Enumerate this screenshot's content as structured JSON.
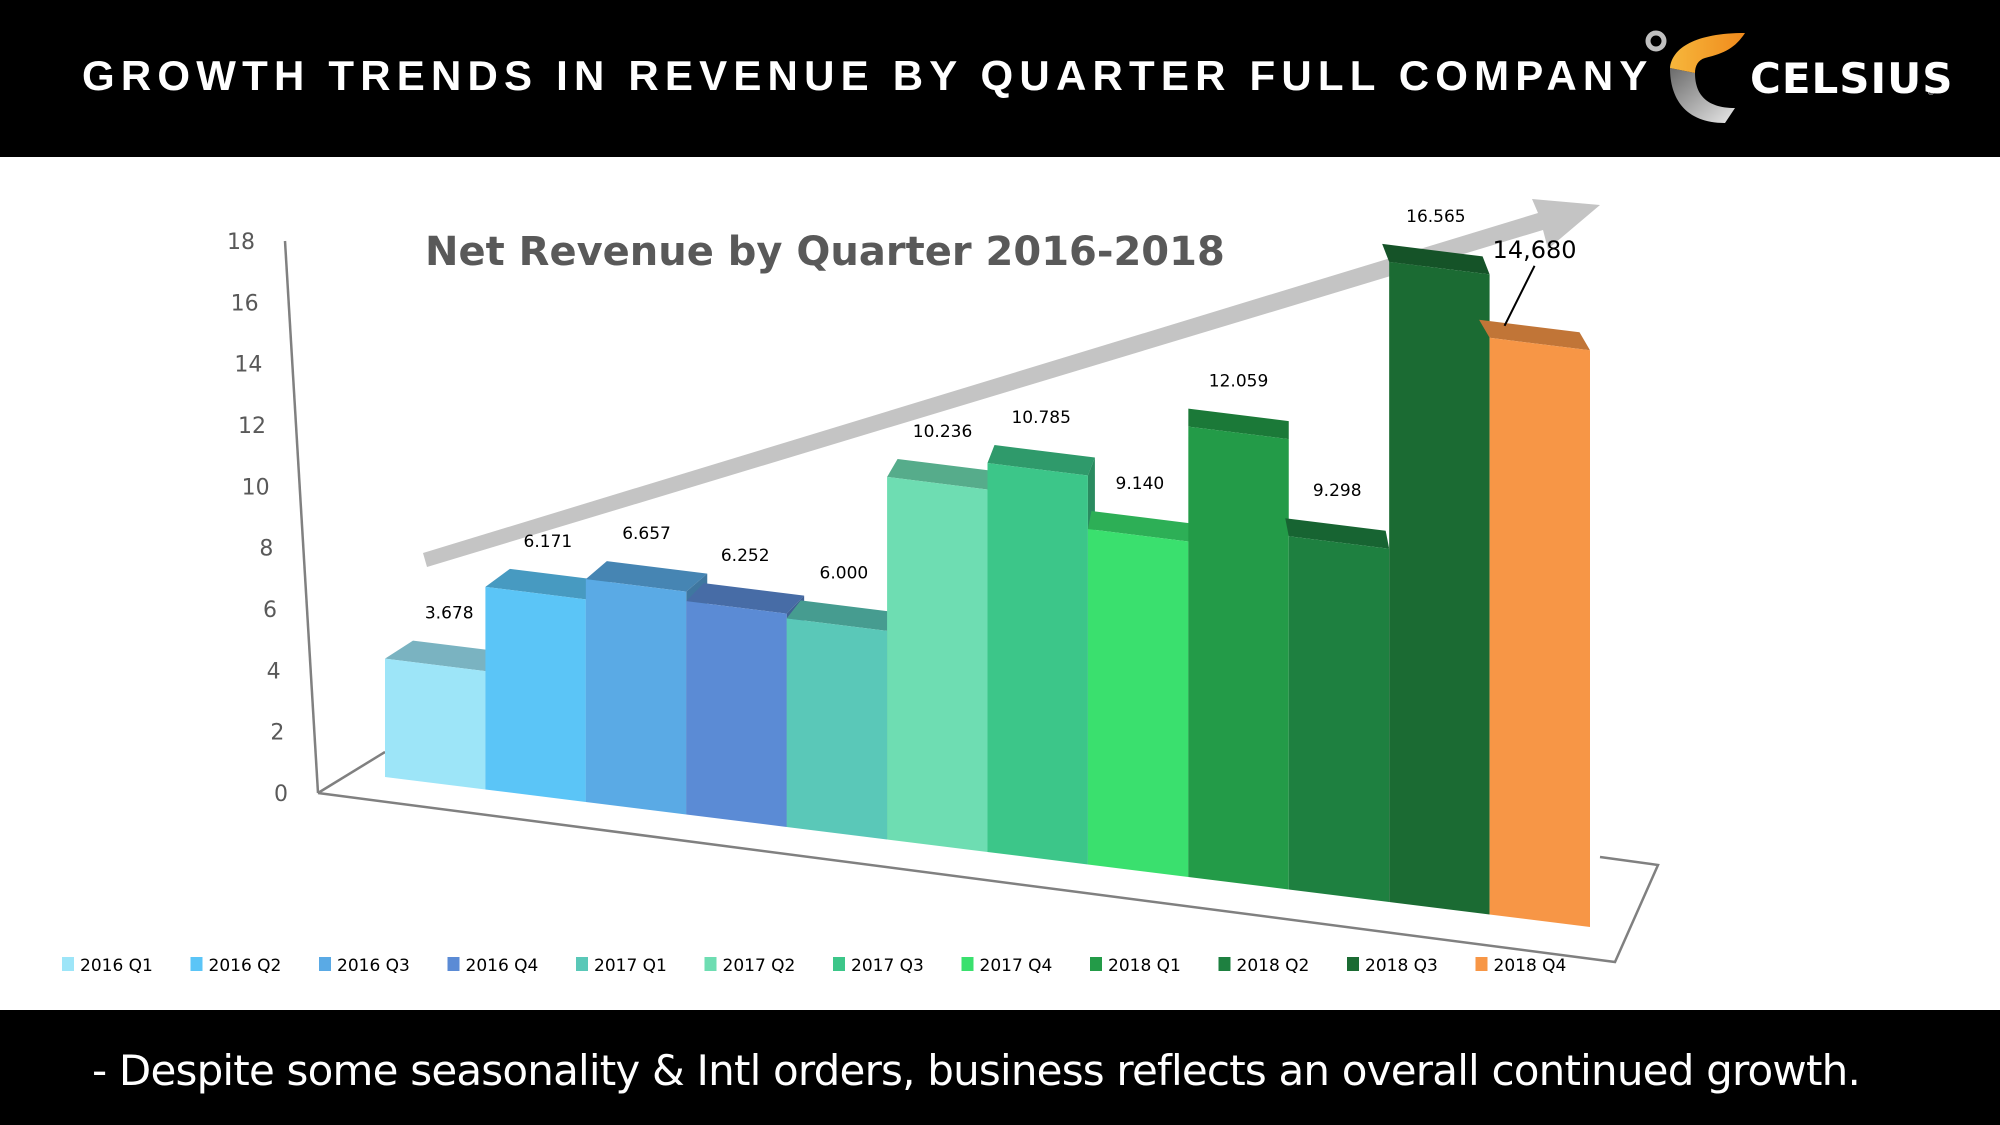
{
  "header": {
    "title": "GROWTH TRENDS IN REVENUE BY QUARTER FULL COMPANY",
    "logo_text": "CELSIUS",
    "logo_reg": "®"
  },
  "footer": {
    "note": "- Despite some seasonality & Intl orders, business reflects an overall continued growth."
  },
  "chart_data": {
    "type": "bar",
    "style": "3d-column",
    "title": "Net Revenue by Quarter 2016-2018",
    "xlabel": "",
    "ylabel": "",
    "ylim": [
      0,
      18
    ],
    "yticks": [
      0,
      2,
      4,
      6,
      8,
      10,
      12,
      14,
      16,
      18
    ],
    "grid": false,
    "legend_position": "bottom",
    "trend_arrow": "up-right",
    "categories": [
      "2016 Q1",
      "2016 Q2",
      "2016 Q3",
      "2016 Q4",
      "2017 Q1",
      "2017 Q2",
      "2017 Q3",
      "2017 Q4",
      "2018 Q1",
      "2018 Q2",
      "2018 Q3",
      "2018 Q4"
    ],
    "values": [
      3.678,
      6.171,
      6.657,
      6.252,
      6.0,
      10.236,
      10.785,
      9.14,
      12.059,
      9.298,
      16.565,
      14.68
    ],
    "data_labels": [
      "3.678",
      "6.171",
      "6.657",
      "6.252",
      "6.000",
      "10.236",
      "10.785",
      "9.140",
      "12.059",
      "9.298",
      "16.565",
      "14,680"
    ],
    "colors": [
      "#9DE5F8",
      "#5BC5F7",
      "#5AAAE5",
      "#5B8BD5",
      "#5AC8B8",
      "#6EDDB2",
      "#3CC689",
      "#3AE06E",
      "#239B48",
      "#1E8040",
      "#1B6B33",
      "#F79646"
    ]
  }
}
